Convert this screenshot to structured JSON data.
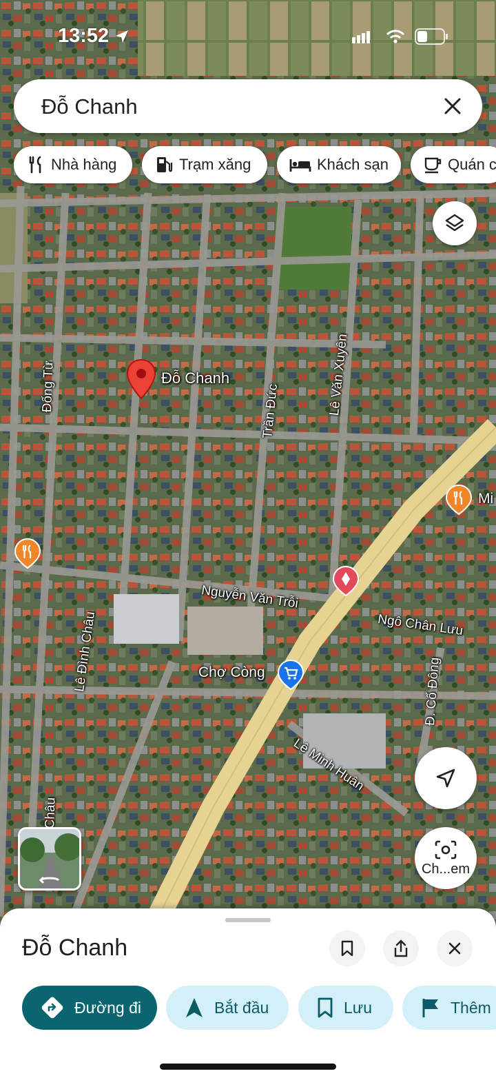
{
  "status_bar": {
    "time": "13:52"
  },
  "search": {
    "query": "Đỗ Chanh"
  },
  "chips": [
    {
      "label": "Nhà hàng",
      "icon": "restaurant-icon"
    },
    {
      "label": "Trạm xăng",
      "icon": "gas-station-icon"
    },
    {
      "label": "Khách sạn",
      "icon": "hotel-icon"
    },
    {
      "label": "Quán c",
      "icon": "cafe-icon"
    }
  ],
  "map": {
    "pin_label": "Đỗ Chanh",
    "streets": {
      "dong_tu": "Đống Từ",
      "tran_duc": "Trần Đức",
      "le_van_xuyen": "Lê Văn Xuyên",
      "nguyen_van_troi": "Nguyễn Văn Trỗi",
      "ngo_chan_luu": "Ngô Chân Lưu",
      "le_dinh_chau": "Lê Đình Châu",
      "co_dong": "Đ. Cổ Đông",
      "le_minh_huan": "Lê Minh Huân",
      "chau": "Châu"
    },
    "poi_cho_cong": "Chợ Còng",
    "poi_right_partial": "Mi",
    "colors": {
      "pin": "#ea4335",
      "restaurant_pin": "#f0862a",
      "shop_pin": "#1a73e8",
      "highway": "#e6d392"
    }
  },
  "lens": {
    "label": "Ch...em"
  },
  "sheet": {
    "title": "Đỗ Chanh",
    "actions": {
      "directions": "Đường đi",
      "start": "Bắt đầu",
      "save": "Lưu",
      "more": "Thêm"
    }
  }
}
